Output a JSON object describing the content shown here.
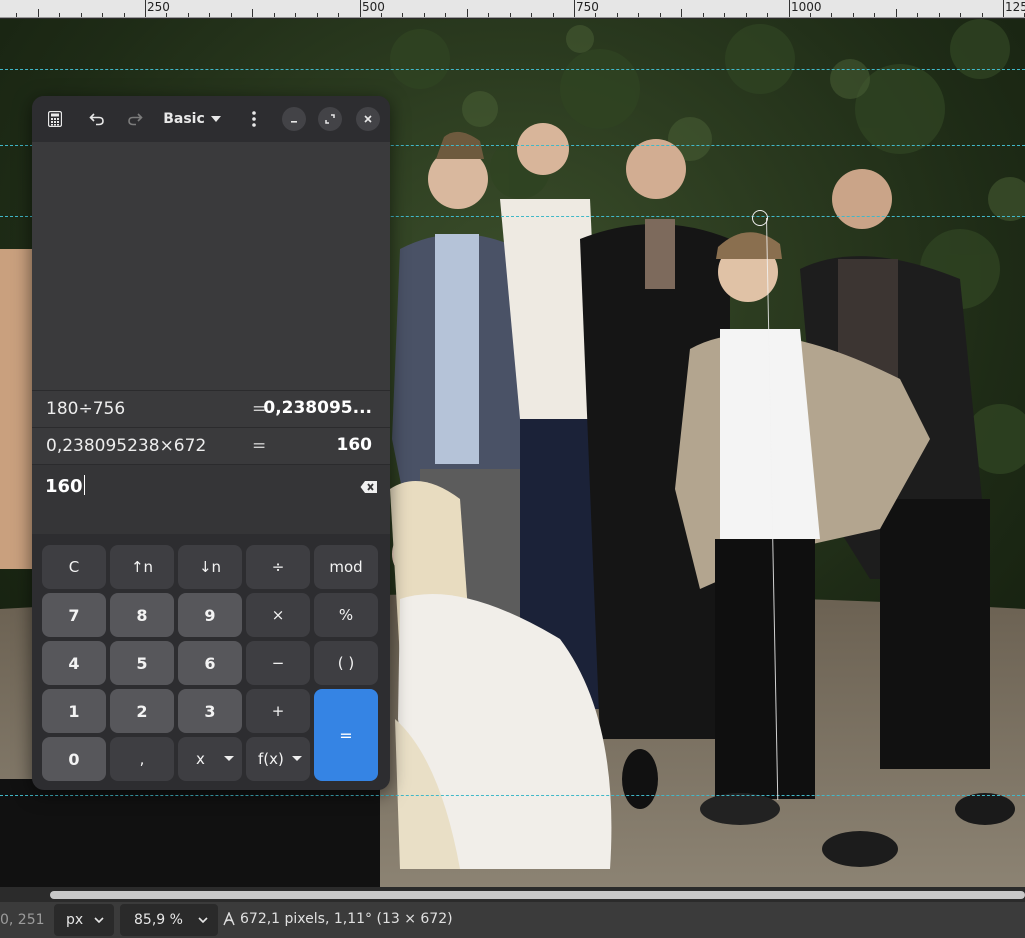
{
  "ruler": {
    "labels": [
      "250",
      "500",
      "750",
      "1000",
      "125"
    ]
  },
  "calculator": {
    "mode_label": "Basic",
    "history": [
      {
        "expression": "180÷756",
        "equals": "=",
        "result": "0,238095..."
      },
      {
        "expression": "0,238095238×672",
        "equals": "=",
        "result": "160"
      }
    ],
    "entry_value": "160",
    "keys": {
      "clear": "C",
      "up_n": "↑n",
      "down_n": "↓n",
      "divide": "÷",
      "mod": "mod",
      "seven": "7",
      "eight": "8",
      "nine": "9",
      "multiply": "×",
      "percent": "%",
      "four": "4",
      "five": "5",
      "six": "6",
      "minus": "−",
      "parens": "( )",
      "one": "1",
      "two": "2",
      "three": "3",
      "plus": "+",
      "zero": "0",
      "comma": ",",
      "x": "x",
      "fx": "f(x)",
      "equals": "="
    },
    "accent_color": "#3584e4"
  },
  "statusbar": {
    "coords": "0, 251",
    "unit": "px",
    "zoom": "85,9 %",
    "measure_text": "672,1 pixels, 1,11° (13 × 672)"
  },
  "icons": [
    "calculator-icon",
    "undo-icon",
    "redo-icon",
    "menu-icon",
    "minimize-icon",
    "maximize-icon",
    "close-icon",
    "backspace-icon",
    "measure-icon",
    "chevron-down-icon"
  ]
}
